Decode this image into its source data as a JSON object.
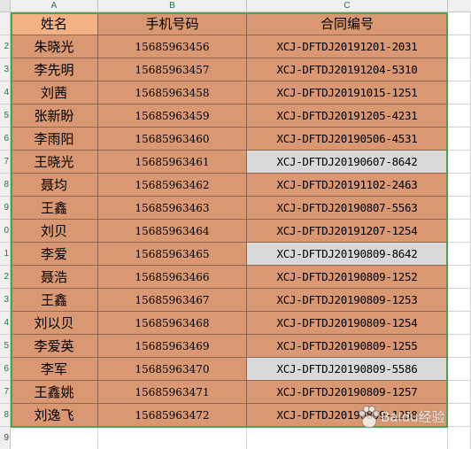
{
  "columns": [
    "A",
    "B",
    "C"
  ],
  "headers": {
    "name": "姓名",
    "phone": "手机号码",
    "contract": "合同编号"
  },
  "rows": [
    {
      "name": "朱晓光",
      "phone": "15685963456",
      "contract": "XCJ-DFTDJ20191201-2031",
      "highlight": false
    },
    {
      "name": "李先明",
      "phone": "15685963457",
      "contract": "XCJ-DFTDJ20191204-5310",
      "highlight": false
    },
    {
      "name": "刘茜",
      "phone": "15685963458",
      "contract": "XCJ-DFTDJ20191015-1251",
      "highlight": false
    },
    {
      "name": "张新盼",
      "phone": "15685963459",
      "contract": "XCJ-DFTDJ20191205-4231",
      "highlight": false
    },
    {
      "name": "李雨阳",
      "phone": "15685963460",
      "contract": "XCJ-DFTDJ20190506-4531",
      "highlight": false
    },
    {
      "name": "王晓光",
      "phone": "15685963461",
      "contract": "XCJ-DFTDJ20190607-8642",
      "highlight": true
    },
    {
      "name": "聂均",
      "phone": "15685963462",
      "contract": "XCJ-DFTDJ20191102-2463",
      "highlight": false
    },
    {
      "name": "王鑫",
      "phone": "15685963463",
      "contract": "XCJ-DFTDJ20190807-5563",
      "highlight": false
    },
    {
      "name": "刘贝",
      "phone": "15685963464",
      "contract": "XCJ-DFTDJ20191207-1254",
      "highlight": false
    },
    {
      "name": "李爱",
      "phone": "15685963465",
      "contract": "XCJ-DFTDJ20190809-8642",
      "highlight": true
    },
    {
      "name": "聂浩",
      "phone": "15685963466",
      "contract": "XCJ-DFTDJ20190809-1252",
      "highlight": false
    },
    {
      "name": "王鑫",
      "phone": "15685963467",
      "contract": "XCJ-DFTDJ20190809-1253",
      "highlight": false
    },
    {
      "name": "刘以贝",
      "phone": "15685963468",
      "contract": "XCJ-DFTDJ20190809-1254",
      "highlight": false
    },
    {
      "name": "李爱英",
      "phone": "15685963469",
      "contract": "XCJ-DFTDJ20190809-1255",
      "highlight": false
    },
    {
      "name": "李军",
      "phone": "15685963470",
      "contract": "XCJ-DFTDJ20190809-5586",
      "highlight": true
    },
    {
      "name": "王鑫姚",
      "phone": "15685963471",
      "contract": "XCJ-DFTDJ20190809-1257",
      "highlight": false
    },
    {
      "name": "刘逸飞",
      "phone": "15685963472",
      "contract": "XCJ-DFTDJ20190809-1258",
      "highlight": false
    }
  ],
  "row_numbers": [
    "",
    "2",
    "3",
    "4",
    "5",
    "6",
    "7",
    "8",
    "9",
    "0",
    "1",
    "2",
    "3",
    "4",
    "5",
    "6",
    "7",
    "8",
    "9"
  ],
  "watermark": {
    "text": "Baidu经验",
    "icon": "baidu-paw-icon"
  },
  "colors": {
    "cell_fill": "#d99872",
    "header_name_fill": "#f4b183",
    "highlight_fill": "#d9d9d9",
    "selection_border": "#4aa44a",
    "header_text": "#217346"
  }
}
